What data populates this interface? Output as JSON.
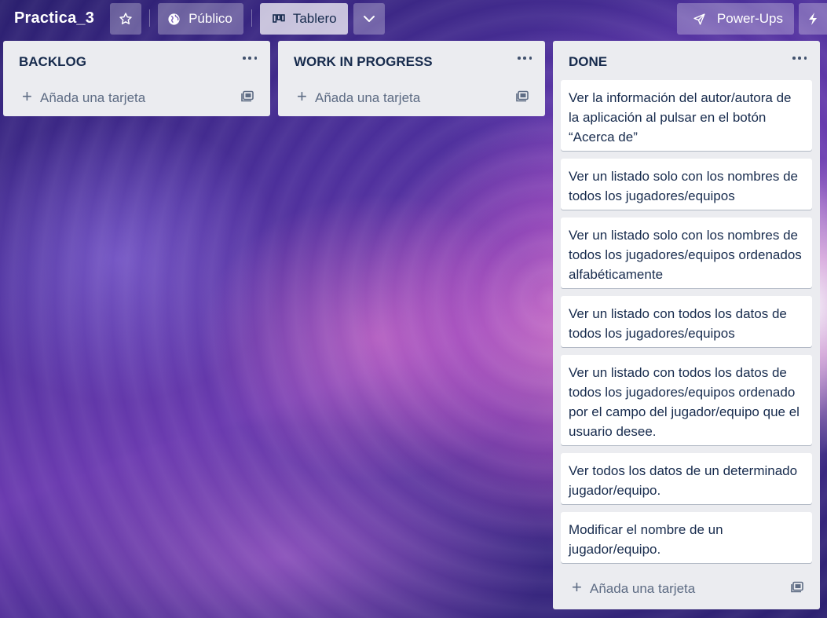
{
  "header": {
    "board_title": "Practica_3",
    "visibility_label": "Público",
    "view_label": "Tablero",
    "powerups_label": "Power-Ups"
  },
  "lists": [
    {
      "title": "BACKLOG",
      "add_card_label": "Añada una tarjeta",
      "cards": []
    },
    {
      "title": "WORK IN PROGRESS",
      "add_card_label": "Añada una tarjeta",
      "cards": []
    },
    {
      "title": "DONE",
      "add_card_label": "Añada una tarjeta",
      "cards": [
        "Ver la información del autor/autora de la aplicación al pulsar en el botón “Acerca de”",
        "Ver un listado solo con los nombres de todos los jugadores/equipos",
        "Ver un listado solo con los nombres de todos los jugadores/equipos ordenados alfabéticamente",
        "Ver un listado con todos los datos de todos los jugadores/equipos",
        "Ver un listado con todos los datos de todos los jugadores/equipos ordenado por el campo del jugador/equipo que el usuario desee.",
        "Ver todos los datos de un determinado jugador/equipo.",
        "Modificar el nombre de un jugador/equipo."
      ]
    }
  ],
  "colors": {
    "list_bg": "#ebecf0",
    "card_bg": "#ffffff",
    "text": "#172b4d",
    "muted": "#5e6c84"
  }
}
